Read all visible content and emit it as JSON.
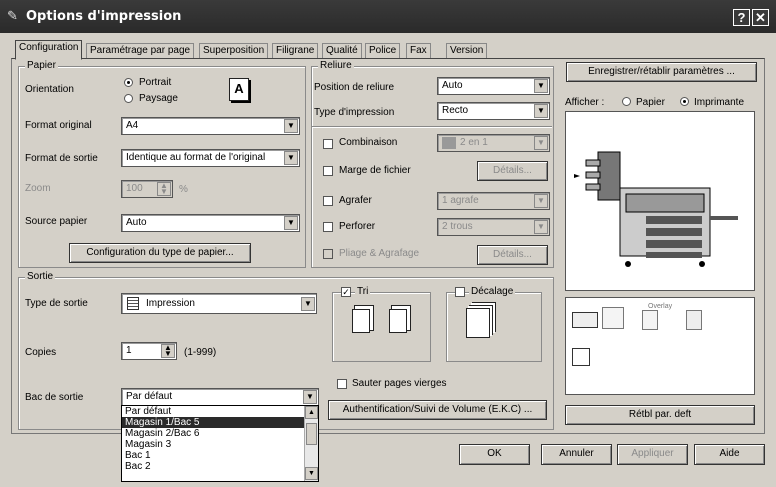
{
  "window": {
    "title": "Options d'impression",
    "help": "?",
    "close": "✕"
  },
  "tabs": [
    "Configuration",
    "Paramétrage par page",
    "Superposition",
    "Filigrane",
    "Qualité",
    "Police",
    "Fax",
    "Version"
  ],
  "papier": {
    "legend": "Papier",
    "orientation_label": "Orientation",
    "portrait": "Portrait",
    "paysage": "Paysage",
    "orientation_icon": "A",
    "format_original_label": "Format original",
    "format_original": "A4",
    "format_sortie_label": "Format de sortie",
    "format_sortie": "Identique au format de l'original",
    "zoom_label": "Zoom",
    "zoom": "100",
    "zoom_unit": "%",
    "source_label": "Source papier",
    "source": "Auto",
    "config_button": "Configuration du type de papier..."
  },
  "reliure": {
    "legend": "Reliure",
    "position_label": "Position de reliure",
    "position": "Auto",
    "type_label": "Type d'impression",
    "type": "Recto",
    "combinaison": "Combinaison",
    "combinaison_value": "2 en 1",
    "marge": "Marge de fichier",
    "details1": "Détails...",
    "agrafer": "Agrafer",
    "agrafer_value": "1 agrafe",
    "perforer": "Perforer",
    "perforer_value": "2 trous",
    "pliage": "Pliage & Agrafage",
    "details2": "Détails..."
  },
  "sortie": {
    "legend": "Sortie",
    "type_label": "Type de sortie",
    "type": "Impression",
    "copies_label": "Copies",
    "copies": "1",
    "copies_range": "(1-999)",
    "bac_label": "Bac de sortie",
    "bac": "Par défaut",
    "bac_options": [
      "Par défaut",
      "Magasin 1/Bac 5",
      "Magasin 2/Bac 6",
      "Magasin 3",
      "Bac 1",
      "Bac 2"
    ],
    "bac_selected_index": 1,
    "tri": "Tri",
    "decalage": "Décalage",
    "sauter": "Sauter pages vierges",
    "auth_button": "Authentification/Suivi de Volume (E.K.C) ..."
  },
  "right": {
    "save_button": "Enregistrer/rétablir paramètres ...",
    "afficher_label": "Afficher :",
    "papier": "Papier",
    "imprimante": "Imprimante",
    "overlay": "Overlay",
    "default_button": "Rétbl par. deft"
  },
  "footer": {
    "ok": "OK",
    "annuler": "Annuler",
    "appliquer": "Appliquer",
    "aide": "Aide"
  }
}
